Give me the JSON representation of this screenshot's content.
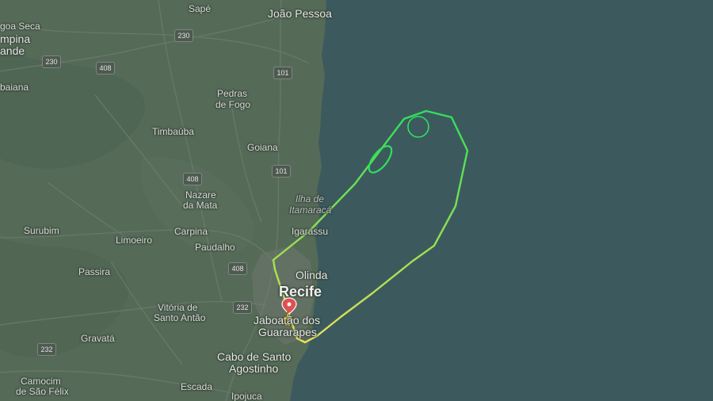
{
  "map": {
    "colors": {
      "land": "#556b58",
      "sea": "#3c5a5e",
      "track_start": "#f0e060",
      "track_end": "#2fe05a"
    },
    "places": {
      "sape": "Sapé",
      "joao_pessoa": "João Pessoa",
      "lagoa_seca": "goa Seca",
      "campina_grande_1": "mpina",
      "campina_grande_2": "ande",
      "itabaiana": "baiana",
      "pedras_de_fogo_1": "Pedras",
      "pedras_de_fogo_2": "de Fogo",
      "timbauba": "Timbaúba",
      "goiana": "Goiana",
      "nazare_1": "Nazare",
      "nazare_2": "da Mata",
      "ilha_1": "Ilha de",
      "ilha_2": "Itamaracá",
      "surubim": "Surubim",
      "limoeiro": "Limoeiro",
      "carpina": "Carpina",
      "igarassu": "Igarassu",
      "paudalho": "Paudalho",
      "olinda": "Olinda",
      "passira": "Passira",
      "recife": "Recife",
      "vitoria_1": "Vitória de",
      "vitoria_2": "Santo Antão",
      "jaboatao_1": "Jaboatão dos",
      "jaboatao_2": "Guararapes",
      "gravata": "Gravatá",
      "cabo_1": "Cabo de Santo",
      "cabo_2": "Agostinho",
      "camocim_1": "Camocim",
      "camocim_2": "de São Félix",
      "escada": "Escada",
      "ipojuca": "Ipojuca"
    },
    "shields": {
      "r230a": "230",
      "r230b": "230",
      "r408a": "408",
      "r101a": "101",
      "r101b": "101",
      "r408b": "408",
      "r408c": "408",
      "r232a": "232",
      "r232b": "232"
    },
    "icons": {
      "aircraft": "airplane-icon",
      "origin": "location-pin-icon"
    }
  }
}
